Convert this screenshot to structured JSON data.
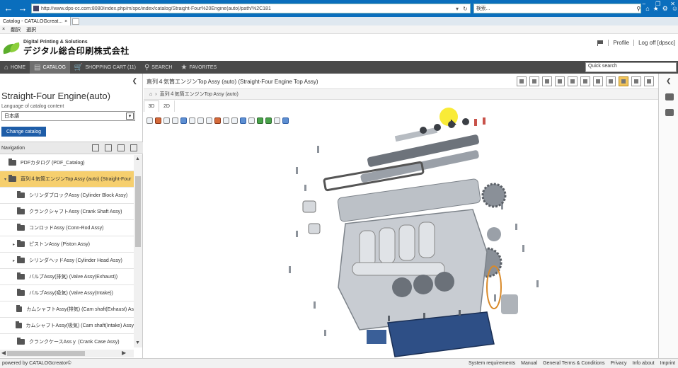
{
  "browser": {
    "url": "http://www.dps-cc.com:8080/index.php/m/spc/index/catalog/Straight-Four%20Engine(auto)/path/%2C181",
    "search_placeholder": "検索...",
    "tab_title": "Catalog - CATALOGcreat...",
    "favorites": [
      "翻訳",
      "選択"
    ]
  },
  "header": {
    "logo_sub": "Digital Printing & Solutions",
    "logo_main": "デジタル総合印刷株式会社",
    "profile": "Profile",
    "logoff": "Log off [dpscc]"
  },
  "menu": {
    "items": [
      {
        "label": "HOME",
        "icon": "home-icon"
      },
      {
        "label": "CATALOG",
        "icon": "catalog-icon"
      },
      {
        "label": "SHOPPING CART (11)",
        "icon": "cart-icon"
      },
      {
        "label": "SEARCH",
        "icon": "search-icon"
      },
      {
        "label": "FAVORITES",
        "icon": "star-icon"
      }
    ],
    "quick_search_placeholder": "Quick search"
  },
  "left": {
    "title": "Straight-Four Engine(auto)",
    "lang_label": "Language of catalog content",
    "lang_value": "日本語",
    "change_button": "Change catalog",
    "nav_label": "Navigation",
    "tree": [
      {
        "label": "PDFカタログ (PDF_Catalog)",
        "level": 0,
        "expander": false,
        "selected": false
      },
      {
        "label": "直列４気筒エンジンTop Assy (auto) (Straight-Four",
        "level": 0,
        "expander": true,
        "selected": true
      },
      {
        "label": "シリンダブロックAssy (Cylinder Block Assy)",
        "level": 1,
        "expander": false,
        "selected": false
      },
      {
        "label": "クランクシャフトAssy (Crank Shaft Assy)",
        "level": 1,
        "expander": false,
        "selected": false
      },
      {
        "label": "コンロッドAssy (Conn-Rod Assy)",
        "level": 1,
        "expander": false,
        "selected": false
      },
      {
        "label": "ピストンAssy (Piston Assy)",
        "level": 1,
        "expander": true,
        "selected": false
      },
      {
        "label": "シリンダヘッドAssy (Cylinder Head Assy)",
        "level": 1,
        "expander": true,
        "selected": false
      },
      {
        "label": "バルブAssy(排気) (Valve Assy(Exhaust))",
        "level": 1,
        "expander": false,
        "selected": false
      },
      {
        "label": "バルブAssy(吸気) (Valve Assy(Intake))",
        "level": 1,
        "expander": false,
        "selected": false
      },
      {
        "label": "カムシャフトAssy(排気) (Cam shaft(Exhaust) As",
        "level": 1,
        "expander": false,
        "selected": false
      },
      {
        "label": "カムシャフトAssy(吸気) (Cam shaft(Intake) Assy",
        "level": 1,
        "expander": false,
        "selected": false
      },
      {
        "label": "クランクケースAssｙ (Crank Case Assy)",
        "level": 1,
        "expander": false,
        "selected": false
      }
    ]
  },
  "content": {
    "title": "直列４気筒エンジンTop Assy (auto) (Straight-Four Engine Top Assy)",
    "breadcrumb": "直列４気筒エンジンTop Assy (auto)",
    "tabs": [
      "3D",
      "2D"
    ]
  },
  "footer": {
    "powered": "powered by CATALOGcreator©",
    "links": [
      "System requirements",
      "Manual",
      "General Terms & Conditions",
      "Privacy",
      "Info about",
      "Imprint"
    ]
  },
  "colors": {
    "menu_bg": "#4a4a4a",
    "selected_row": "#f6cf6e",
    "change_button": "#1e5da8",
    "engine_block": "#c8ccd2",
    "oil_pan": "#2e4f86"
  }
}
